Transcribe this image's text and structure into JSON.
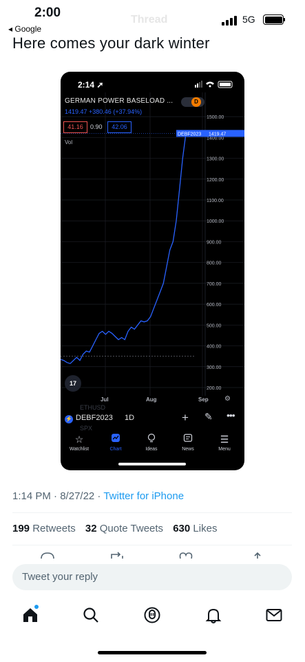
{
  "status_bar": {
    "time": "2:00",
    "back_label": "◂ Google",
    "network": "5G"
  },
  "header": {
    "ghost_title": "Thread"
  },
  "tweet": {
    "text": "Here comes your dark winter",
    "time": "1:14 PM",
    "date": "8/27/22",
    "separator": " · ",
    "source": "Twitter for iPhone",
    "reply_placeholder": "Tweet your reply"
  },
  "stats": [
    {
      "count": "199",
      "label": "Retweets"
    },
    {
      "count": "32",
      "label": "Quote Tweets"
    },
    {
      "count": "630",
      "label": "Likes"
    }
  ],
  "embedded_app": {
    "time": "2:14",
    "symbol_title": "GERMAN POWER BASELOAD ...",
    "price_line": "1419.47 +380.46 (+37.94%)",
    "interval_badge": "D",
    "bid": "41.16",
    "spread": "0.90",
    "ask": "42.06",
    "volume_label": "Vol",
    "tv_logo": "17",
    "ghost_symbols": [
      "ETHUSD",
      "SPX"
    ],
    "toolbar_symbol": "DEBF2023",
    "toolbar_interval": "1D",
    "nav": [
      {
        "label": "Watchlist",
        "icon": "star-icon"
      },
      {
        "label": "Chart",
        "icon": "chart-icon",
        "active": true
      },
      {
        "label": "Ideas",
        "icon": "lightbulb-icon"
      },
      {
        "label": "News",
        "icon": "news-icon"
      },
      {
        "label": "Menu",
        "icon": "menu-icon"
      }
    ]
  },
  "chart_data": {
    "type": "line",
    "series": [
      {
        "name": "DEBF2023",
        "x": [
          0,
          2,
          4,
          6,
          8,
          10,
          12,
          14,
          16,
          18,
          20,
          22,
          24,
          26,
          28,
          30,
          32,
          34,
          36,
          38,
          40,
          42,
          44,
          46,
          48,
          50,
          52,
          54,
          56,
          58,
          60,
          62,
          64,
          66,
          68,
          70,
          72,
          74,
          76,
          78,
          80,
          82,
          84,
          86,
          88,
          90
        ],
        "values": [
          335,
          330,
          320,
          315,
          330,
          345,
          330,
          360,
          375,
          370,
          400,
          430,
          460,
          470,
          455,
          470,
          460,
          445,
          430,
          440,
          430,
          470,
          490,
          480,
          500,
          520,
          515,
          520,
          540,
          580,
          620,
          660,
          700,
          780,
          860,
          900,
          1000,
          1150,
          1300,
          1419.47,
          1419.47,
          1419.47,
          1419.47,
          1419.47,
          1419.47,
          1419.47
        ]
      }
    ],
    "ylim": [
      200,
      1550
    ],
    "y_ticks": [
      "1500.00",
      "1400.00",
      "1300.00",
      "1200.00",
      "1100.00",
      "1000.00",
      "900.00",
      "800.00",
      "700.00",
      "600.00",
      "500.00",
      "400.00",
      "300.00",
      "200.00"
    ],
    "x_ticks": [
      "Jul",
      "Aug",
      "Sep"
    ],
    "last_value_label": "1419.47",
    "symbol_label": "DEBF2023",
    "grid": true
  },
  "tab_bar": [
    {
      "name": "home-icon"
    },
    {
      "name": "search-icon"
    },
    {
      "name": "spaces-icon"
    },
    {
      "name": "notifications-icon"
    },
    {
      "name": "messages-icon"
    }
  ]
}
